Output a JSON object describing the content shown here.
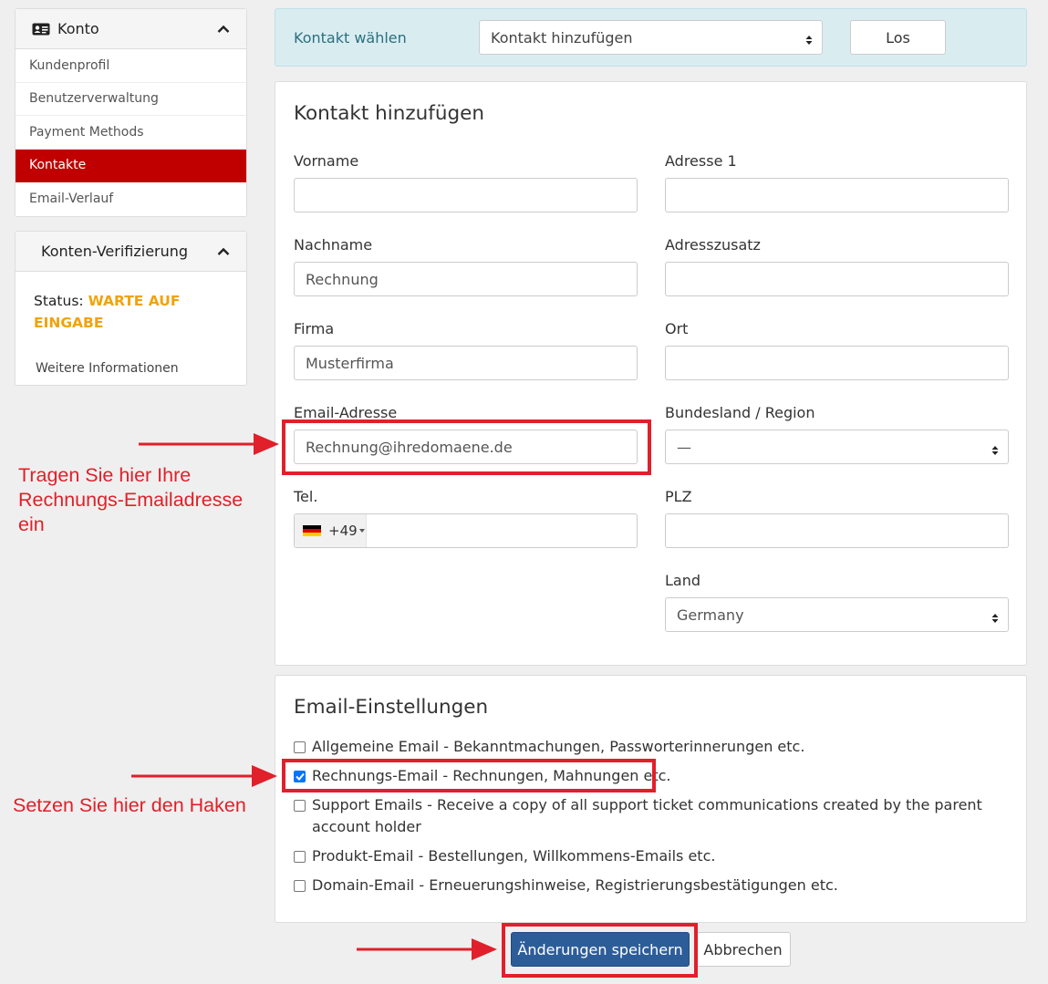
{
  "sidebar": {
    "account": {
      "title": "Konto",
      "items": [
        {
          "label": "Kundenprofil",
          "active": false
        },
        {
          "label": "Benutzerverwaltung",
          "active": false
        },
        {
          "label": "Payment Methods",
          "active": false
        },
        {
          "label": "Kontakte",
          "active": true
        },
        {
          "label": "Email-Verlauf",
          "active": false
        }
      ]
    },
    "verification": {
      "title": "Konten-Verifizierung",
      "status_label": "Status:",
      "status_value": "WARTE AUF EINGABE",
      "more_info": "Weitere Informationen"
    }
  },
  "contact_select": {
    "label": "Kontakt wählen",
    "selected": "Kontakt hinzufügen",
    "go_button": "Los"
  },
  "form": {
    "title": "Kontakt hinzufügen",
    "fields": {
      "firstname": {
        "label": "Vorname",
        "value": ""
      },
      "lastname": {
        "label": "Nachname",
        "value": "Rechnung"
      },
      "company": {
        "label": "Firma",
        "value": "Musterfirma"
      },
      "email": {
        "label": "Email-Adresse",
        "value": "Rechnung@ihredomaene.de"
      },
      "phone": {
        "label": "Tel.",
        "dial_code": "+49",
        "value": ""
      },
      "address1": {
        "label": "Adresse 1",
        "value": ""
      },
      "address2": {
        "label": "Adresszusatz",
        "value": ""
      },
      "city": {
        "label": "Ort",
        "value": ""
      },
      "state": {
        "label": "Bundesland / Region",
        "value": "—"
      },
      "postcode": {
        "label": "PLZ",
        "value": ""
      },
      "country": {
        "label": "Land",
        "value": "Germany"
      }
    }
  },
  "email_settings": {
    "title": "Email-Einstellungen",
    "options": [
      {
        "label": "Allgemeine Email - Bekanntmachungen, Passworterinnerungen etc.",
        "checked": false
      },
      {
        "label": "Rechnungs-Email - Rechnungen, Mahnungen etc.",
        "checked": true
      },
      {
        "label": "Support Emails - Receive a copy of all support ticket communications created by the parent account holder",
        "checked": false
      },
      {
        "label": "Produkt-Email - Bestellungen, Willkommens-Emails etc.",
        "checked": false
      },
      {
        "label": "Domain-Email - Erneuerungshinweise, Registrierungsbestätigungen etc.",
        "checked": false
      }
    ]
  },
  "actions": {
    "save": "Änderungen speichern",
    "cancel": "Abbrechen"
  },
  "annotations": {
    "email_hint": "Tragen Sie hier Ihre Rechnungs-Emailadresse ein",
    "checkbox_hint": "Setzen Sie hier den Haken"
  },
  "colors": {
    "accent_red": "#c00000",
    "annotation_red": "#e0202a",
    "primary_blue": "#2d5d99",
    "warning_orange": "#f0a30a",
    "info_bg": "#d9edf1"
  }
}
